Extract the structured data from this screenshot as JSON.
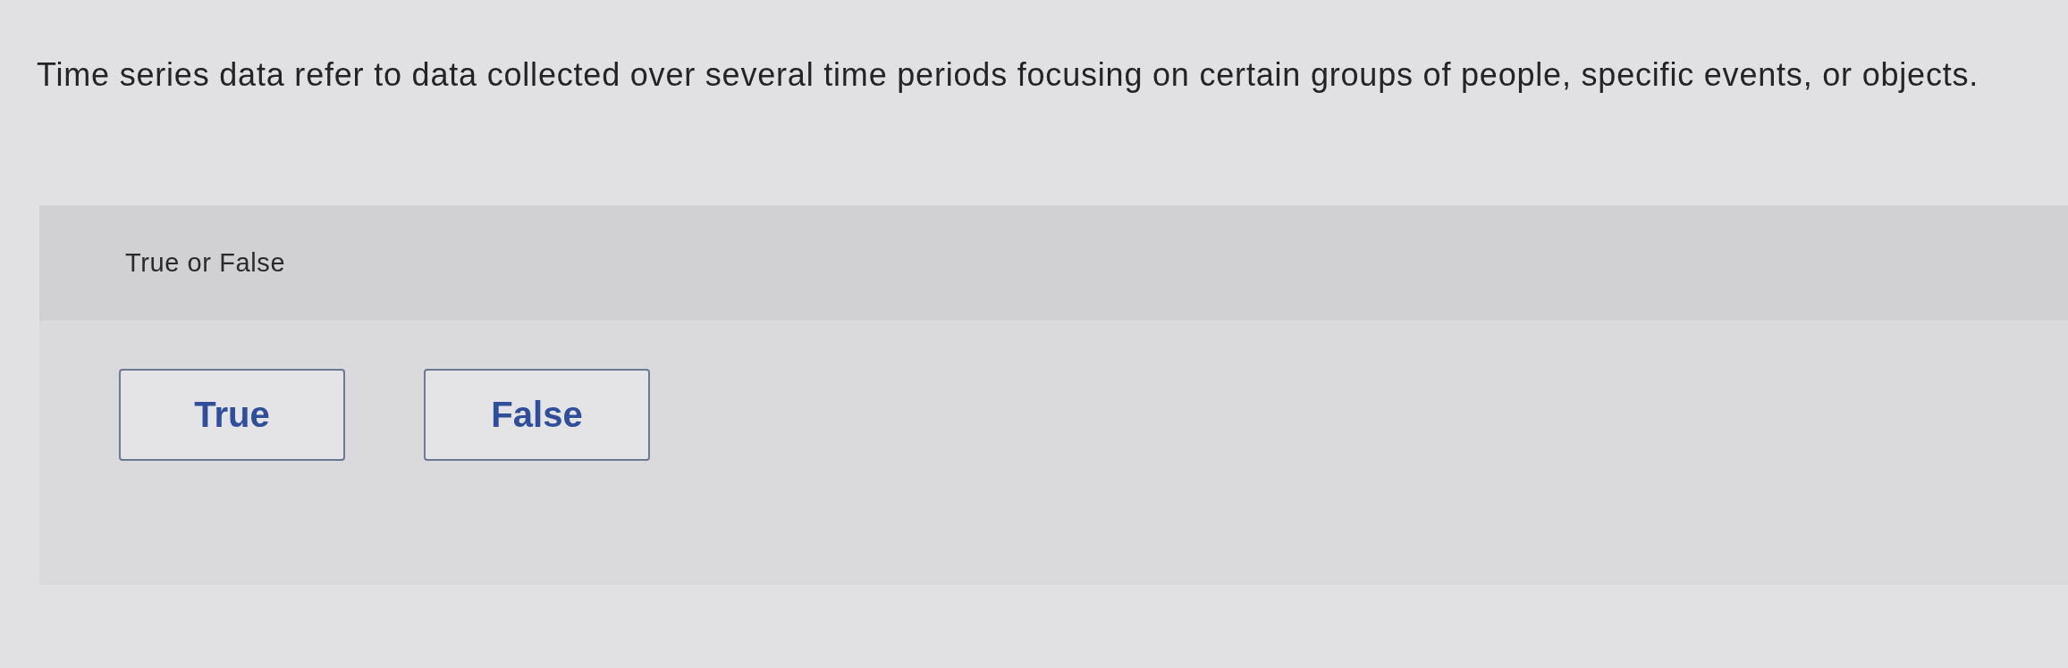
{
  "question": {
    "text": "Time series data refer to data collected over several time periods focusing on certain groups of people, specific events, or objects."
  },
  "panel": {
    "prompt": "True or False",
    "options": [
      {
        "label": "True",
        "selected": false
      },
      {
        "label": "False",
        "selected": false
      }
    ]
  }
}
